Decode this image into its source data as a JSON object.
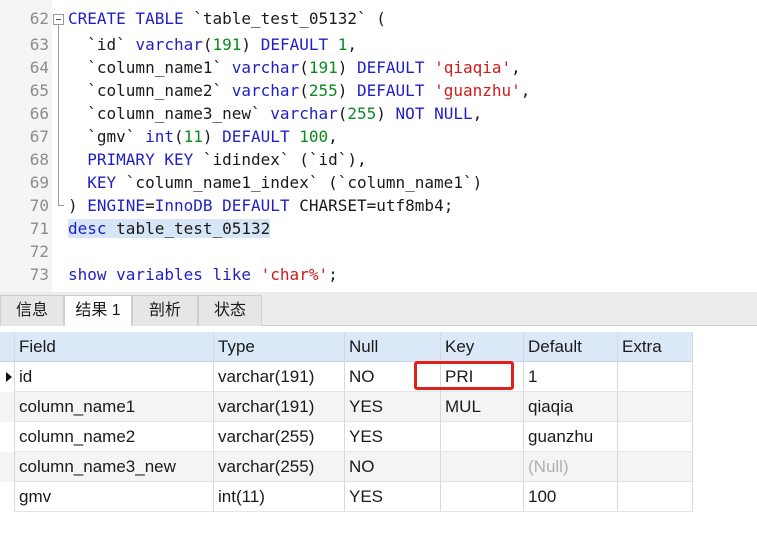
{
  "editor": {
    "lines": [
      {
        "num": "62",
        "tokens": [
          {
            "t": "CREATE TABLE ",
            "c": "kw"
          },
          {
            "t": "`table_test_05132` (",
            "c": "plain"
          }
        ]
      },
      {
        "num": "63",
        "tokens": [
          {
            "t": "  `id` ",
            "c": "plain"
          },
          {
            "t": "varchar",
            "c": "kw"
          },
          {
            "t": "(",
            "c": "plain"
          },
          {
            "t": "191",
            "c": "num"
          },
          {
            "t": ") ",
            "c": "plain"
          },
          {
            "t": "DEFAULT ",
            "c": "kw"
          },
          {
            "t": "1",
            "c": "num"
          },
          {
            "t": ",",
            "c": "plain"
          }
        ]
      },
      {
        "num": "64",
        "tokens": [
          {
            "t": "  `column_name1` ",
            "c": "plain"
          },
          {
            "t": "varchar",
            "c": "kw"
          },
          {
            "t": "(",
            "c": "plain"
          },
          {
            "t": "191",
            "c": "num"
          },
          {
            "t": ") ",
            "c": "plain"
          },
          {
            "t": "DEFAULT ",
            "c": "kw"
          },
          {
            "t": "'qiaqia'",
            "c": "str"
          },
          {
            "t": ",",
            "c": "plain"
          }
        ]
      },
      {
        "num": "65",
        "tokens": [
          {
            "t": "  `column_name2` ",
            "c": "plain"
          },
          {
            "t": "varchar",
            "c": "kw"
          },
          {
            "t": "(",
            "c": "plain"
          },
          {
            "t": "255",
            "c": "num"
          },
          {
            "t": ") ",
            "c": "plain"
          },
          {
            "t": "DEFAULT ",
            "c": "kw"
          },
          {
            "t": "'guanzhu'",
            "c": "str"
          },
          {
            "t": ",",
            "c": "plain"
          }
        ]
      },
      {
        "num": "66",
        "tokens": [
          {
            "t": "  `column_name3_new` ",
            "c": "plain"
          },
          {
            "t": "varchar",
            "c": "kw"
          },
          {
            "t": "(",
            "c": "plain"
          },
          {
            "t": "255",
            "c": "num"
          },
          {
            "t": ") ",
            "c": "plain"
          },
          {
            "t": "NOT NULL",
            "c": "kw"
          },
          {
            "t": ",",
            "c": "plain"
          }
        ]
      },
      {
        "num": "67",
        "tokens": [
          {
            "t": "  `gmv` ",
            "c": "plain"
          },
          {
            "t": "int",
            "c": "kw"
          },
          {
            "t": "(",
            "c": "plain"
          },
          {
            "t": "11",
            "c": "num"
          },
          {
            "t": ") ",
            "c": "plain"
          },
          {
            "t": "DEFAULT ",
            "c": "kw"
          },
          {
            "t": "100",
            "c": "num"
          },
          {
            "t": ",",
            "c": "plain"
          }
        ]
      },
      {
        "num": "68",
        "tokens": [
          {
            "t": "  ",
            "c": "plain"
          },
          {
            "t": "PRIMARY KEY ",
            "c": "kw"
          },
          {
            "t": "`idindex` (`id`),",
            "c": "plain"
          }
        ]
      },
      {
        "num": "69",
        "tokens": [
          {
            "t": "  ",
            "c": "plain"
          },
          {
            "t": "KEY ",
            "c": "kw"
          },
          {
            "t": "`column_name1_index` (`column_name1`)",
            "c": "plain"
          }
        ]
      },
      {
        "num": "70",
        "tokens": [
          {
            "t": ") ",
            "c": "plain"
          },
          {
            "t": "ENGINE",
            "c": "kw"
          },
          {
            "t": "=",
            "c": "plain"
          },
          {
            "t": "InnoDB ",
            "c": "kw"
          },
          {
            "t": "DEFAULT ",
            "c": "kw"
          },
          {
            "t": "CHARSET=utf8mb4;",
            "c": "plain"
          }
        ]
      },
      {
        "num": "71",
        "tokens": [
          {
            "t": "desc ",
            "c": "kw sel"
          },
          {
            "t": "table_test_05132",
            "c": "plain sel"
          }
        ]
      },
      {
        "num": "72",
        "tokens": []
      },
      {
        "num": "73",
        "tokens": [
          {
            "t": "show variables like ",
            "c": "kw"
          },
          {
            "t": "'char%'",
            "c": "str"
          },
          {
            "t": ";",
            "c": "plain"
          }
        ]
      }
    ]
  },
  "tabs": [
    {
      "label": "信息",
      "active": false
    },
    {
      "label": "结果 1",
      "active": true
    },
    {
      "label": "剖析",
      "active": false
    },
    {
      "label": "状态",
      "active": false
    }
  ],
  "grid": {
    "columns": [
      "Field",
      "Type",
      "Null",
      "Key",
      "Default",
      "Extra"
    ],
    "rows": [
      {
        "Field": "id",
        "Type": "varchar(191)",
        "Null": "NO",
        "Key": "PRI",
        "Default": "1",
        "Extra": ""
      },
      {
        "Field": "column_name1",
        "Type": "varchar(191)",
        "Null": "YES",
        "Key": "MUL",
        "Default": "qiaqia",
        "Extra": ""
      },
      {
        "Field": "column_name2",
        "Type": "varchar(255)",
        "Null": "YES",
        "Key": "",
        "Default": "guanzhu",
        "Extra": ""
      },
      {
        "Field": "column_name3_new",
        "Type": "varchar(255)",
        "Null": "NO",
        "Key": "",
        "Default": "(Null)",
        "Extra": ""
      },
      {
        "Field": "gmv",
        "Type": "int(11)",
        "Null": "YES",
        "Key": "",
        "Default": "100",
        "Extra": ""
      }
    ]
  },
  "colors": {
    "keyword": "#1f1fc8",
    "number": "#098a1f",
    "string": "#d01a1a",
    "header_bg": "#dbe8f7",
    "highlight_box": "#e0211b"
  }
}
